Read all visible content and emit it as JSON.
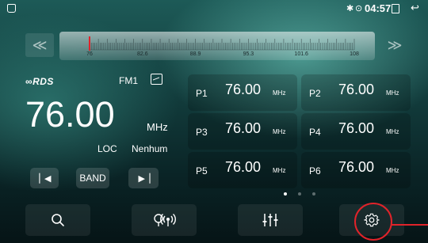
{
  "statusbar": {
    "bt_icon": "bluetooth-icon",
    "bt_glyph": "✱",
    "location_icon": "location-pin-icon",
    "location_glyph": "⊙",
    "time": "04:57",
    "window_icon": "recent-apps-icon",
    "back_icon": "back-arrow-icon",
    "back_glyph": "↩"
  },
  "tuner": {
    "prev_glyph": "≪",
    "next_glyph": "≫",
    "scale_labels": [
      "76",
      "82.6",
      "88.9",
      "95.3",
      "101.6",
      "108"
    ],
    "scale_min": 76,
    "scale_max": 108,
    "needle_value": 76.0
  },
  "station": {
    "rds_logo": "RDS",
    "rds_prefix": "∞",
    "band": "FM1",
    "frequency": "76.00",
    "unit": "MHz",
    "loc": "LOC",
    "rds_name": "Nenhum"
  },
  "controls": {
    "seek_back_glyph": "▏◀",
    "band_label": "BAND",
    "seek_fwd_glyph": "▶▕"
  },
  "presets": [
    {
      "label": "P1",
      "freq": "76.00",
      "unit": "MHz"
    },
    {
      "label": "P2",
      "freq": "76.00",
      "unit": "MHz"
    },
    {
      "label": "P3",
      "freq": "76.00",
      "unit": "MHz"
    },
    {
      "label": "P4",
      "freq": "76.00",
      "unit": "MHz"
    },
    {
      "label": "P5",
      "freq": "76.00",
      "unit": "MHz"
    },
    {
      "label": "P6",
      "freq": "76.00",
      "unit": "MHz"
    }
  ],
  "pager": {
    "pages": 3,
    "active": 1
  },
  "bottombar": {
    "buttons": [
      "search-icon",
      "radio-broadcast-icon",
      "equalizer-icon",
      "settings-icon"
    ]
  },
  "colors": {
    "highlight": "#e0232a",
    "needle": "#e0232a"
  }
}
